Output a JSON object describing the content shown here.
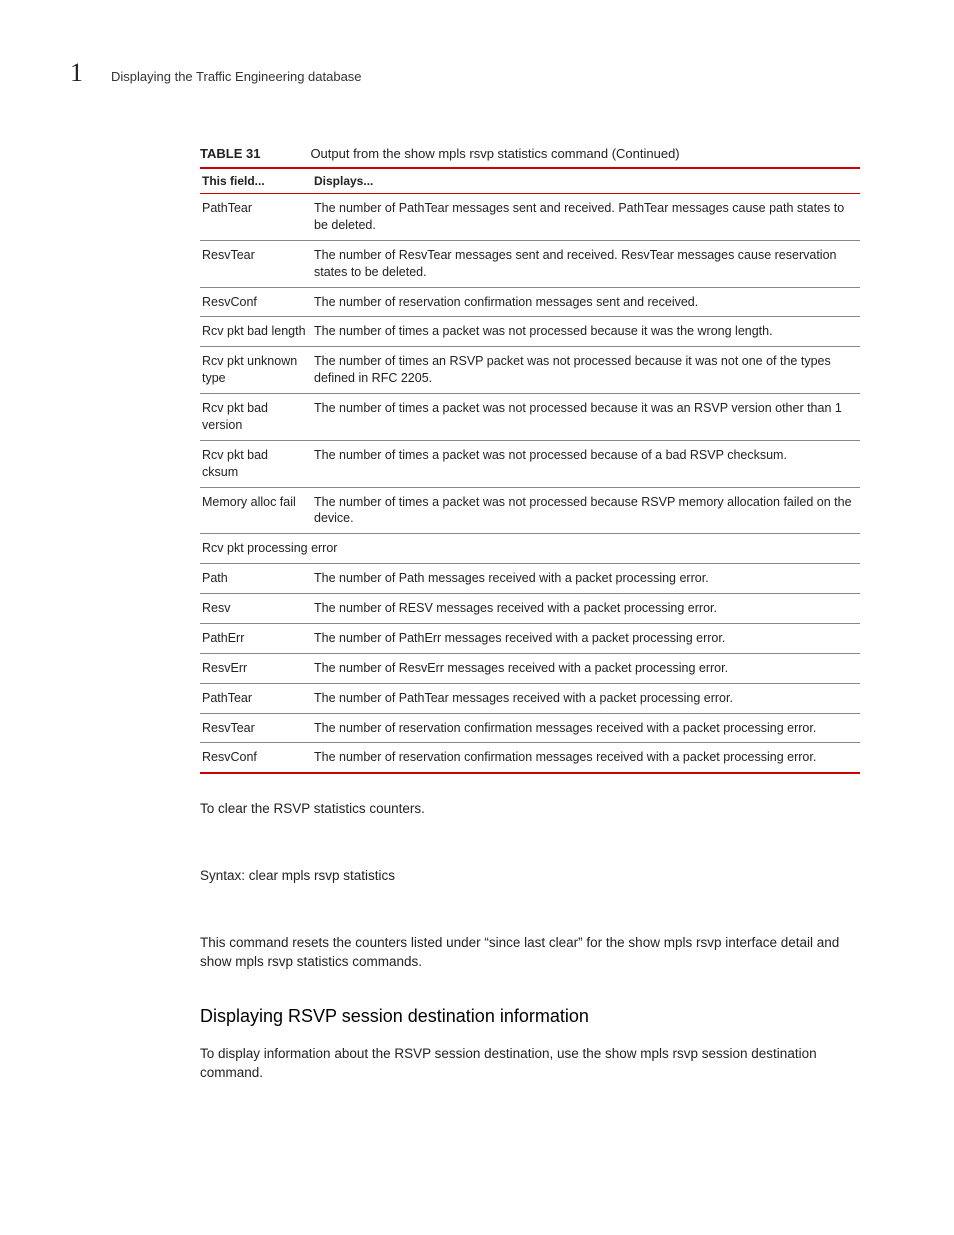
{
  "header": {
    "chapter_number": "1",
    "running_title": "Displaying the Traffic Engineering database"
  },
  "table": {
    "label": "TABLE 31",
    "title": "Output from the show mpls rsvp statistics command  (Continued)",
    "head_field": "This field...",
    "head_displays": "Displays...",
    "rows": [
      {
        "field": "PathTear",
        "desc": "The number of PathTear messages sent and received. PathTear messages cause path states to be deleted."
      },
      {
        "field": "ResvTear",
        "desc": "The number of ResvTear messages sent and received. ResvTear messages cause reservation states to be deleted."
      },
      {
        "field": "ResvConf",
        "desc": "The number of reservation confirmation messages sent and received."
      },
      {
        "field": "Rcv pkt bad length",
        "desc": "The number of times a packet was not processed because it was the wrong length."
      },
      {
        "field": "Rcv pkt unknown type",
        "desc": "The number of times an RSVP packet was not processed because it was not one of the types defined in RFC 2205."
      },
      {
        "field": "Rcv pkt bad version",
        "desc": "The number of times a packet was not processed because it was an RSVP version other than 1"
      },
      {
        "field": "Rcv pkt bad cksum",
        "desc": "The number of times a packet was not processed because of a bad RSVP checksum."
      },
      {
        "field": "Memory alloc fail",
        "desc": "The number of times a packet was not processed because RSVP memory allocation failed on the device."
      }
    ],
    "span_row": "Rcv pkt processing error",
    "rows2": [
      {
        "field": "Path",
        "desc": "The number of Path messages received with a packet processing error."
      },
      {
        "field": "Resv",
        "desc": "The number of RESV messages received with a packet processing error."
      },
      {
        "field": "PathErr",
        "desc": "The number of PathErr messages received with a packet processing error."
      },
      {
        "field": "ResvErr",
        "desc": "The number of ResvErr messages received with a packet processing error."
      },
      {
        "field": "PathTear",
        "desc": "The number of PathTear messages received with a packet processing error."
      },
      {
        "field": "ResvTear",
        "desc": "The number of reservation confirmation messages received with a packet processing error."
      },
      {
        "field": "ResvConf",
        "desc": "The number of reservation confirmation messages received with a packet processing error."
      }
    ]
  },
  "body": {
    "p1": "To clear the RSVP statistics counters.",
    "p2": "Syntax:  clear mpls rsvp statistics",
    "p3": "This command resets the counters listed under “since last clear” for the show mpls rsvp interface detail and show mpls rsvp statistics commands.",
    "h2": "Displaying RSVP session destination information",
    "p4": "To display information about the RSVP session destination, use the show mpls rsvp session destination command."
  }
}
